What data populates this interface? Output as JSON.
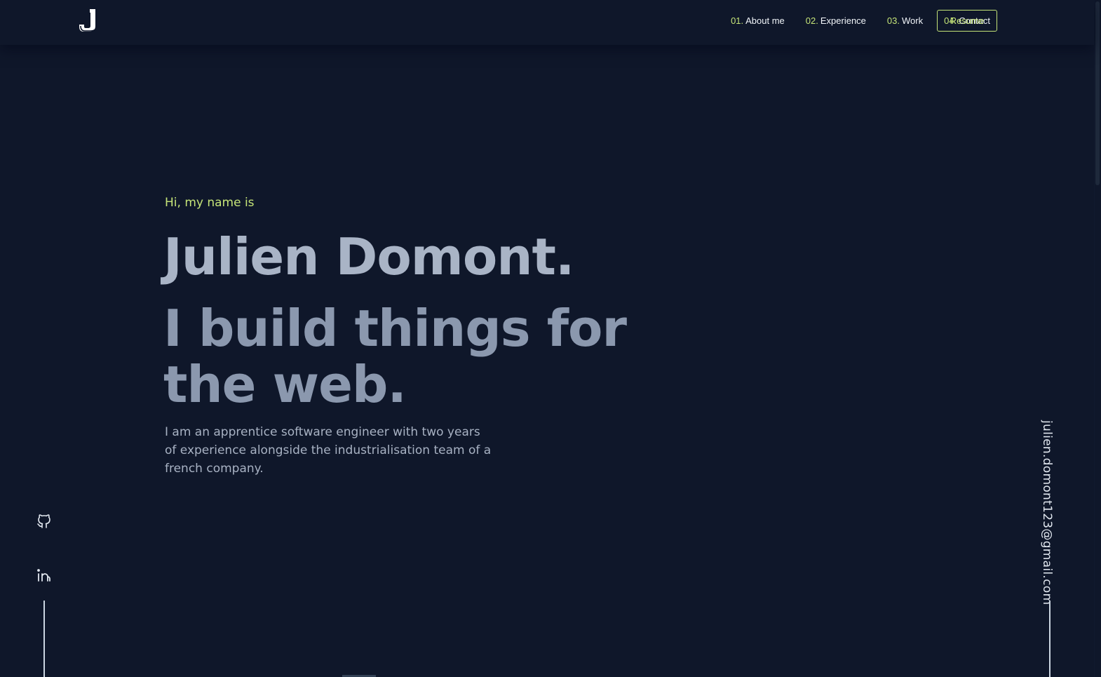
{
  "colors": {
    "background": "#0f172a",
    "accent": "#c5e478",
    "name_text": "#a9b4c6",
    "tagline_text": "#8b98ae",
    "body_text": "#a8b2c3",
    "white": "#f1f5f9"
  },
  "header": {
    "logo_icon": "j-logo-icon",
    "nav": [
      {
        "num": "01.",
        "label": "About me"
      },
      {
        "num": "02.",
        "label": "Experience"
      },
      {
        "num": "03.",
        "label": "Work"
      },
      {
        "num": "04.",
        "label": "Contact"
      }
    ],
    "resume_label": "Resume"
  },
  "hero": {
    "greeting": "Hi, my name is",
    "name": "Julien Domont.",
    "tagline": "I build things for the web.",
    "description": "I am an apprentice software engineer with two years of experience alongside the industrialisation team of a french company."
  },
  "social": {
    "icons": [
      "github-icon",
      "linkedin-icon"
    ]
  },
  "email": "julien.domont123@gmail.com"
}
